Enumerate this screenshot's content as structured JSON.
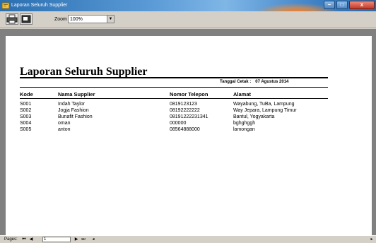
{
  "window": {
    "title": "Laporan Seluruh Supplier",
    "controls": {
      "minimize": "–",
      "maximize": "□",
      "close": "x"
    }
  },
  "toolbar": {
    "icons": [
      "printer-icon",
      "export-icon"
    ],
    "zoom_label": "Zoom",
    "zoom_value": "100%"
  },
  "report": {
    "title": "Laporan Seluruh  Supplier",
    "print_date_label": "Tanggal Cetak :",
    "print_date_value": "07 Agustus 2014",
    "columns": [
      "Kode",
      "Nama Supplier",
      "Nomor Telepon",
      "Alamat"
    ],
    "rows": [
      [
        "S001",
        "Indah Taylor",
        "0819123123",
        "Wayabung, TuBa, Lampung"
      ],
      [
        "S002",
        "Jogja Fashion",
        "08192222222",
        "Way Jepara, Lampung Timur"
      ],
      [
        "S003",
        "Bunafit Fashion",
        "08191222231341",
        "Bantul, Yogyakarta"
      ],
      [
        "S004",
        "oman",
        "000000",
        "bghghggh"
      ],
      [
        "S005",
        "anton",
        "08564888000",
        "lamongan"
      ]
    ]
  },
  "statusbar": {
    "pages_label": "Pages:",
    "current_page": "1",
    "nav": {
      "first": "⏮",
      "prev": "◀",
      "next": "▶",
      "last": "⏭"
    }
  }
}
